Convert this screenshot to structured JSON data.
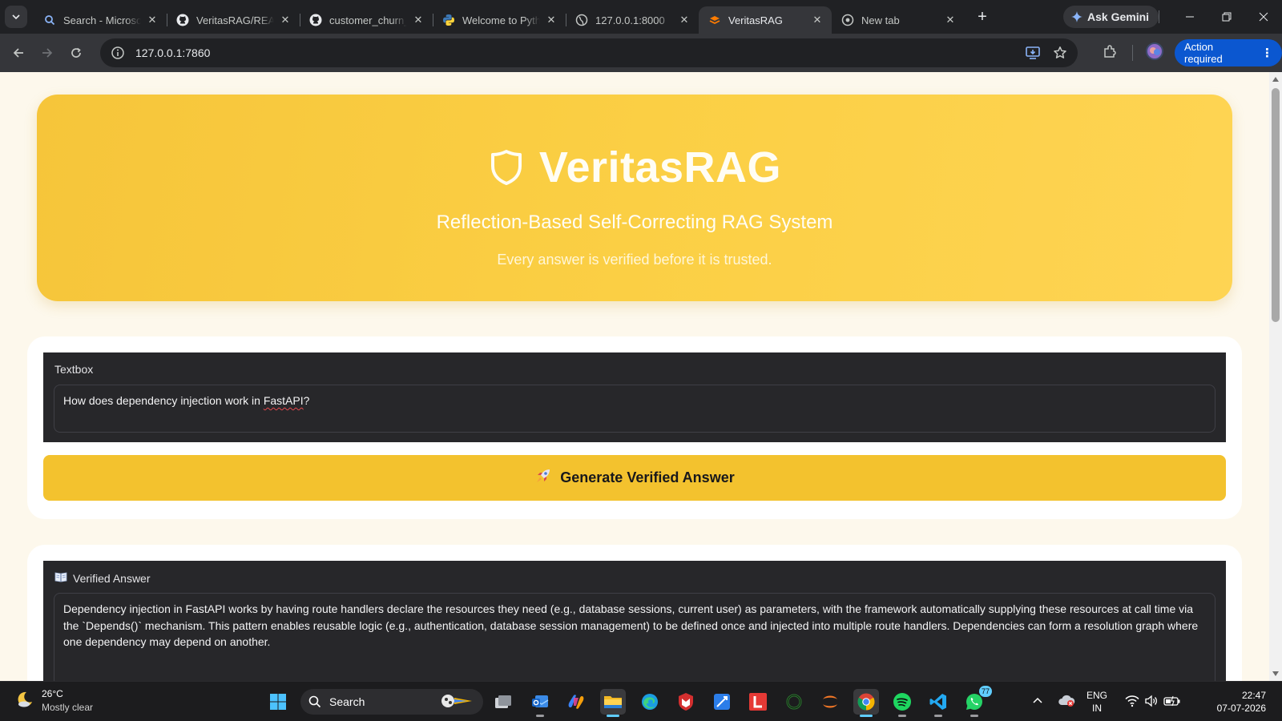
{
  "browser": {
    "tabs": [
      {
        "title": "Search - Microsoft",
        "icon": "search-icon"
      },
      {
        "title": "VeritasRAG/README",
        "icon": "github-icon"
      },
      {
        "title": "customer_churn_p",
        "icon": "github-icon"
      },
      {
        "title": "Welcome to Python",
        "icon": "python-icon"
      },
      {
        "title": "127.0.0.1:8000",
        "icon": "globe-icon"
      },
      {
        "title": "VeritasRAG",
        "icon": "gradio-icon",
        "active": true
      },
      {
        "title": "New tab",
        "icon": "chrome-icon"
      }
    ],
    "ask_gemini_label": "Ask Gemini",
    "url": "127.0.0.1:7860",
    "action_required_label": "Action required"
  },
  "page": {
    "hero": {
      "title": "VeritasRAG",
      "subtitle": "Reflection-Based Self-Correcting RAG System",
      "tagline": "Every answer is verified before it is trusted."
    },
    "input": {
      "label": "Textbox",
      "value_before": "How does dependency injection work in ",
      "value_misspelled": "FastAPI",
      "value_after": "?"
    },
    "generate_button_label": "Generate Verified Answer",
    "output": {
      "label": "Verified Answer",
      "answer": "Dependency injection in FastAPI works by having route handlers declare the resources they need (e.g., database sessions, current user) as parameters, with the framework automatically supplying these resources at call time via the `Depends()` mechanism. This pattern enables reusable logic (e.g., authentication, database session management) to be defined once and injected into multiple route handlers. Dependencies can form a resolution graph where one dependency may depend on another."
    },
    "scroll_fraction": 0
  },
  "taskbar": {
    "weather_temp": "26°C",
    "weather_desc": "Mostly clear",
    "search_label": "Search",
    "lang_line1": "ENG",
    "lang_line2": "IN",
    "time": "22:47",
    "date": "07-07-2026",
    "whatsapp_badge": "77"
  },
  "colors": {
    "accent_yellow": "#f3c22e",
    "chrome_blue": "#0b57d0",
    "page_bg": "#fdf8ec"
  }
}
